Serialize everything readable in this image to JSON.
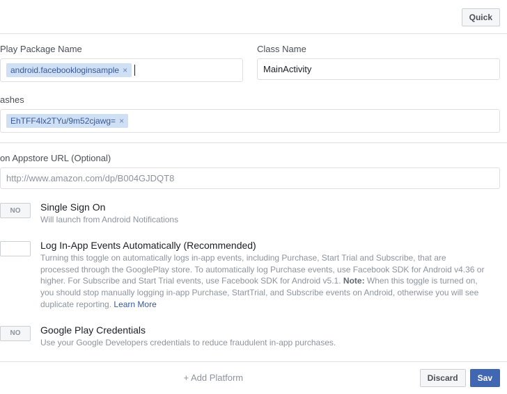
{
  "topbar": {
    "quick": "Quick"
  },
  "packageName": {
    "label": "Play Package Name",
    "tag": "android.facebookloginsample"
  },
  "className": {
    "label": "Class Name",
    "value": "MainActivity"
  },
  "hashes": {
    "label": "ashes",
    "tag": "EhTFF4lx2TYu/9m52cjawg="
  },
  "amazon": {
    "label": "on Appstore URL (Optional)",
    "placeholder": "http://www.amazon.com/dp/B004GJDQT8"
  },
  "sso": {
    "toggle": "No",
    "title": "Single Sign On",
    "desc": "Will launch from Android Notifications"
  },
  "logEvents": {
    "toggle": "",
    "title": "Log In-App Events Automatically (Recommended)",
    "desc1": "Turning this toggle on automatically logs in-app events, including Purchase, Start Trial and Subscribe, that are processed through the GooglePlay store. To automatically log Purchase events, use Facebook SDK for Android v4.36 or higher. For Subscribe and Start Trial events, use Facebook SDK for Android v5.1. ",
    "note": "Note:",
    "desc2": " When this toggle is turned on, you should stop manually logging in-app Purchase, StartTrial, and Subscribe events on Android, otherwise you will see duplicate reporting. ",
    "learn": "Learn More"
  },
  "gplay": {
    "toggle": "NO",
    "title": "Google Play Credentials",
    "desc": "Use your Google Developers credentials to reduce fraudulent in-app purchases."
  },
  "footer": {
    "add": "+ Add Platform",
    "discard": "Discard",
    "save": "Sav"
  }
}
